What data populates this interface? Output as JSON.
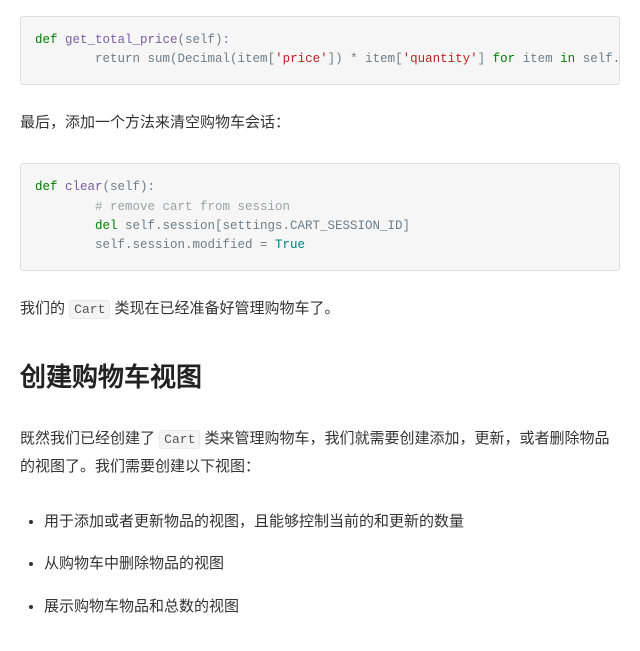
{
  "code1": {
    "t_def": "def ",
    "t_fn": "get_total_price",
    "t_params": "(self):",
    "t_ret": "        return ",
    "t_sum": "sum",
    "t_open": "(Decimal(item[",
    "t_price": "'price'",
    "t_mid": "]) * item[",
    "t_qty": "'quantity'",
    "t_close": "] ",
    "t_for": "for",
    "t_item": " item ",
    "t_in": "in",
    "t_end": " self.cart.values())"
  },
  "para1": "最后，添加一个方法来清空购物车会话：",
  "code2": {
    "t_def": "def ",
    "t_fn": "clear",
    "t_params": "(self):",
    "t_cmt": "        # remove cart from session",
    "t_del": "        del ",
    "t_delarg": "self.session[settings.CART_SESSION_ID]",
    "t_mod": "        self.session.modified = ",
    "t_true": "True"
  },
  "para2": {
    "before": "我们的 ",
    "code": "Cart",
    "after": " 类现在已经准备好管理购物车了。"
  },
  "heading": "创建购物车视图",
  "para3": {
    "before": "既然我们已经创建了 ",
    "code": "Cart",
    "after": " 类来管理购物车，我们就需要创建添加，更新，或者删除物品的视图了。我们需要创建以下视图："
  },
  "bullets": [
    "用于添加或者更新物品的视图，且能够控制当前的和更新的数量",
    "从购物车中删除物品的视图",
    "展示购物车物品和总数的视图"
  ]
}
